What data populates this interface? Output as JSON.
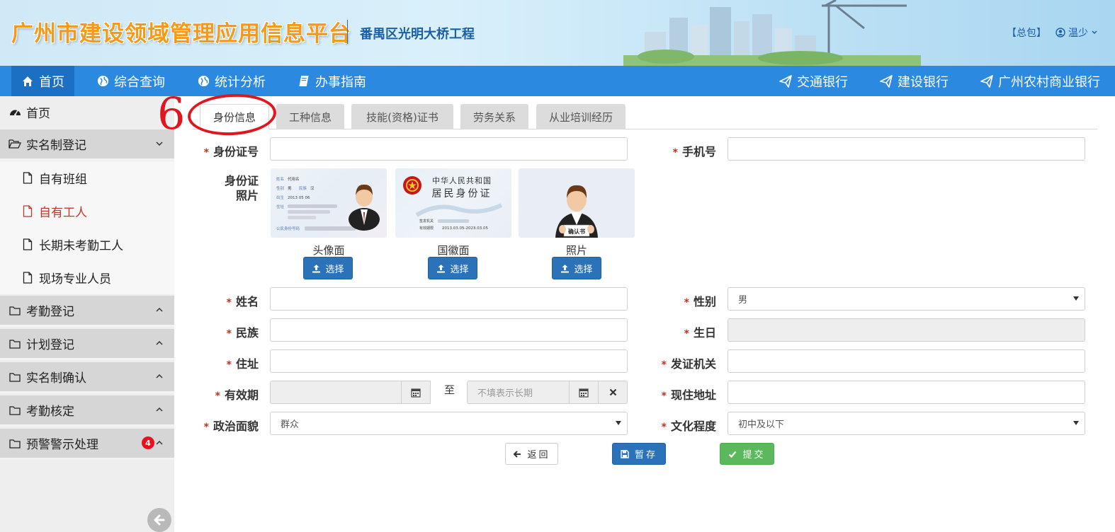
{
  "header": {
    "system_title": "广州市建设领域管理应用信息平台",
    "project_name": "番禺区光明大桥工程",
    "role_label": "【总包】",
    "user_name": "温少"
  },
  "nav": {
    "left": [
      {
        "label": "首页",
        "icon": "home-icon"
      },
      {
        "label": "综合查询",
        "icon": "globe-icon"
      },
      {
        "label": "统计分析",
        "icon": "globe-icon"
      },
      {
        "label": "办事指南",
        "icon": "book-icon"
      }
    ],
    "right": [
      {
        "label": "交通银行",
        "icon": "send-icon"
      },
      {
        "label": "建设银行",
        "icon": "send-icon"
      },
      {
        "label": "广州农村商业银行",
        "icon": "send-icon"
      }
    ]
  },
  "sidebar": {
    "home": "首页",
    "realname_group": "实名制登记",
    "realname_items": [
      "自有班组",
      "自有工人",
      "长期未考勤工人",
      "现场专业人员"
    ],
    "groups": [
      "考勤登记",
      "计划登记",
      "实名制确认",
      "考勤核定",
      "预警警示处理"
    ],
    "warning_badge": "4"
  },
  "annotation": {
    "number": "6"
  },
  "tabs": [
    "身份信息",
    "工种信息",
    "技能(资格)证书",
    "劳务关系",
    "从业培训经历"
  ],
  "form": {
    "id_number_label": "身份证号",
    "phone_label": "手机号",
    "id_photo_label_line1": "身份证",
    "id_photo_label_line2": "照片",
    "photos": [
      {
        "caption": "头像面",
        "button": "选择"
      },
      {
        "caption": "国徽面",
        "button": "选择"
      },
      {
        "caption": "照片",
        "button": "选择"
      }
    ],
    "name_label": "姓名",
    "gender_label": "性别",
    "gender_value": "男",
    "ethnic_label": "民族",
    "birthday_label": "生日",
    "address_label": "住址",
    "issuer_label": "发证机关",
    "validity_label": "有效期",
    "validity_to": "至",
    "validity_end_placeholder": "不填表示长期",
    "current_address_label": "现住地址",
    "political_label": "政治面貌",
    "political_value": "群众",
    "education_label": "文化程度",
    "education_value": "初中及以下"
  },
  "card_front": {
    "name_key": "姓名",
    "name_value": "代用名",
    "gender_key": "性别",
    "gender_value": "男",
    "ethnic_key": "民族",
    "ethnic_value": "汉",
    "birth_key": "出生",
    "birth_value": "2013 05 06",
    "address_key": "住址",
    "id_key": "公民身份号码"
  },
  "card_back": {
    "line1": "中华人民共和国",
    "line2": "居民身份证",
    "issuer_key": "签发机关",
    "validity_key": "有效期限",
    "validity_value": "2013.03.05-2023.03.05"
  },
  "avatar_sign": "确认书",
  "buttons": {
    "back": "返回",
    "save": "暂存",
    "submit": "提交"
  }
}
